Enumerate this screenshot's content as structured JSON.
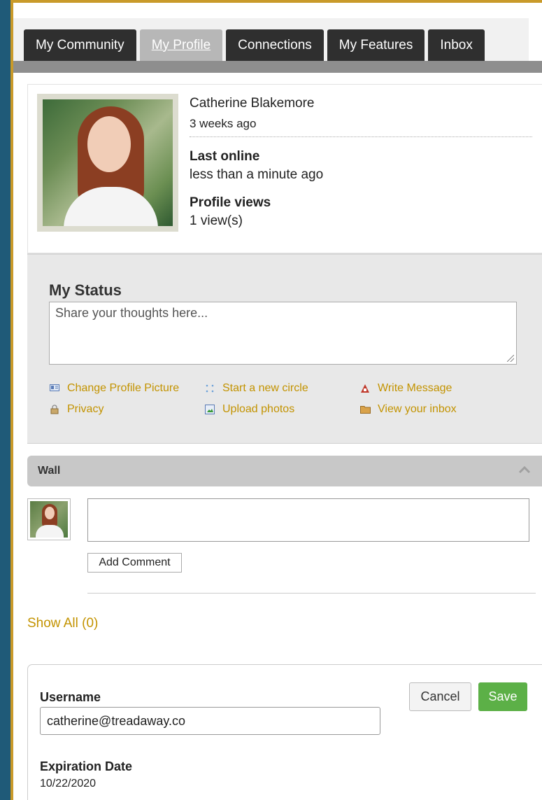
{
  "tabs": [
    {
      "label": "My Community",
      "active": false
    },
    {
      "label": "My Profile",
      "active": true
    },
    {
      "label": "Connections",
      "active": false
    },
    {
      "label": "My Features",
      "active": false
    },
    {
      "label": "Inbox",
      "active": false
    }
  ],
  "profile": {
    "name": "Catherine Blakemore",
    "joined": "3 weeks ago",
    "last_online_label": "Last online",
    "last_online_value": "less than a minute ago",
    "profile_views_label": "Profile views",
    "profile_views_value": "1 view(s)"
  },
  "status": {
    "title": "My Status",
    "placeholder": "Share your thoughts here...",
    "actions": [
      {
        "label": "Change Profile Picture",
        "icon": "id-card-icon"
      },
      {
        "label": "Start a new circle",
        "icon": "circle-dots-icon"
      },
      {
        "label": "Write Message",
        "icon": "write-message-icon"
      },
      {
        "label": "Privacy",
        "icon": "lock-icon"
      },
      {
        "label": "Upload photos",
        "icon": "photo-icon"
      },
      {
        "label": "View your inbox",
        "icon": "inbox-folder-icon"
      }
    ]
  },
  "wall": {
    "title": "Wall",
    "add_comment_label": "Add Comment",
    "show_all_label": "Show All (0)"
  },
  "account": {
    "username_label": "Username",
    "username_value": "catherine@treadaway.co",
    "expiration_label": "Expiration Date",
    "expiration_value": "10/22/2020",
    "cancel_label": "Cancel",
    "save_label": "Save"
  },
  "colors": {
    "background": "#1f5a78",
    "border_accent": "#c99a2a",
    "link": "#c39300",
    "tab_dark": "#2f2f2f",
    "tab_active": "#b7b7b7",
    "save_green": "#5cb047"
  }
}
